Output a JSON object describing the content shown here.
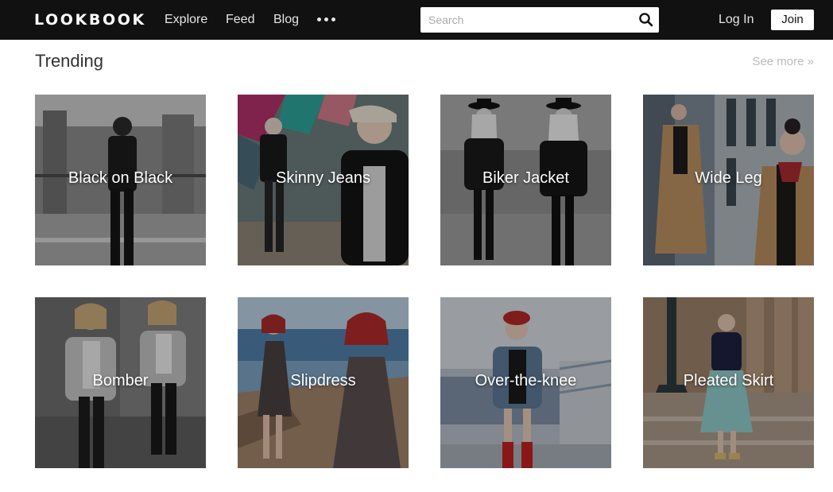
{
  "header": {
    "brand": "LOOKBOOK",
    "nav": {
      "explore": "Explore",
      "feed": "Feed",
      "blog": "Blog"
    },
    "more_icon": "ellipsis-icon",
    "search": {
      "placeholder": "Search",
      "value": "",
      "icon": "search-icon"
    },
    "login_label": "Log In",
    "join_label": "Join"
  },
  "trending": {
    "title": "Trending",
    "see_more": "See more »",
    "tiles": [
      {
        "label": "Black on Black"
      },
      {
        "label": "Skinny Jeans"
      },
      {
        "label": "Biker Jacket"
      },
      {
        "label": "Wide Leg"
      },
      {
        "label": "Bomber"
      },
      {
        "label": "Slipdress"
      },
      {
        "label": "Over-the-knee"
      },
      {
        "label": "Pleated Skirt"
      }
    ]
  },
  "colors": {
    "navbar": "#111111",
    "nav_text": "#e6e6e6",
    "title_text": "#333333",
    "see_more_text": "#bbbbbb"
  }
}
